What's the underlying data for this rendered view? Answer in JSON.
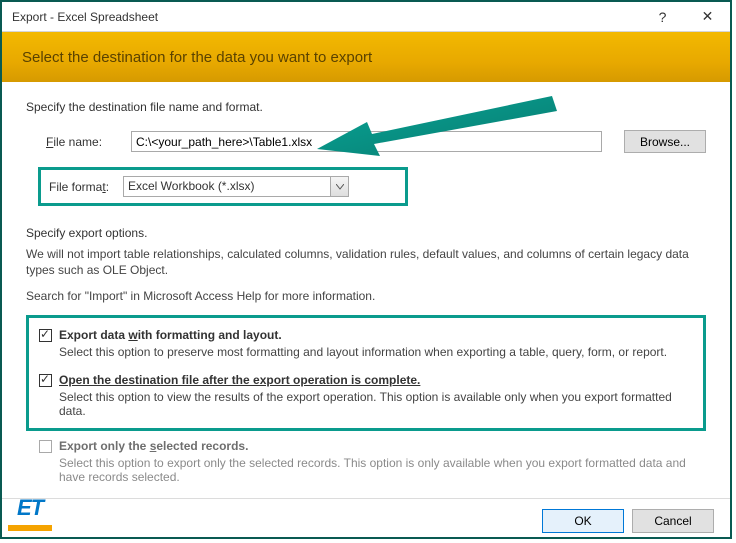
{
  "titlebar": {
    "title": "Export - Excel Spreadsheet",
    "help_char": "?",
    "close_char": "✕"
  },
  "banner": {
    "text": "Select the destination for the data you want to export"
  },
  "dest": {
    "instruction": "Specify the destination file name and format.",
    "filename_label_pre": "",
    "filename_label": "File name:",
    "filename_underline": "F",
    "filename_rest": "ile name:",
    "filename_value": "C:\\<your_path_here>\\Table1.xlsx",
    "browse_label": "Browse...",
    "format_label": "File format:",
    "format_underline_rest": "File forma",
    "format_underline_char": "t",
    "format_suffix": ":",
    "format_value": "Excel Workbook (*.xlsx)"
  },
  "options": {
    "heading": "Specify export options.",
    "warning": "We will not import table relationships, calculated columns, validation rules, default values, and columns of certain legacy data types such as OLE Object.",
    "help_hint": "Search for \"Import\" in Microsoft Access Help for more information.",
    "opt1": {
      "label_pre": "Export data ",
      "label_underline": "w",
      "label_post": "ith formatting and layout.",
      "desc": "Select this option to preserve most formatting and layout information when exporting a table, query, form, or report."
    },
    "opt2": {
      "label_full": "Open the destination file after the export operation is complete.",
      "label_underline_char": "A",
      "desc": "Select this option to view the results of the export operation. This option is available only when you export formatted data."
    },
    "opt3": {
      "label_pre": "Export only the ",
      "label_underline": "s",
      "label_post": "elected records.",
      "desc": "Select this option to export only the selected records. This option is only available when you export formatted data and have records selected."
    }
  },
  "footer": {
    "ok": "OK",
    "cancel": "Cancel"
  },
  "logo": {
    "text": "ET"
  }
}
